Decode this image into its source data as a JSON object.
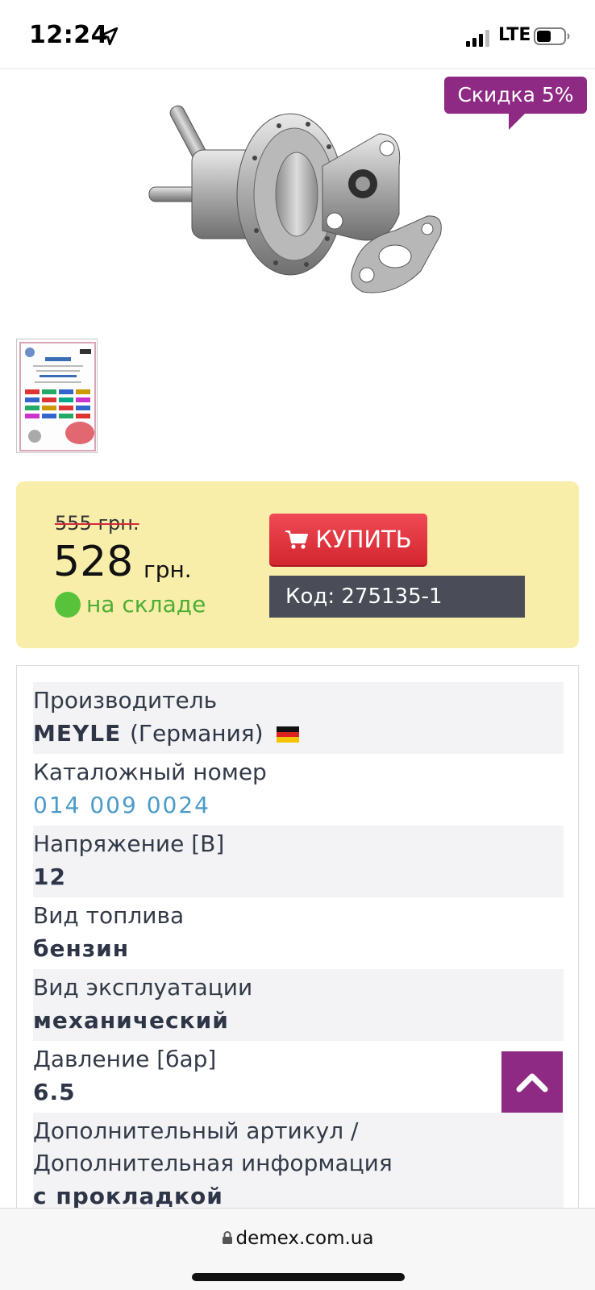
{
  "status_bar": {
    "time": "12:24",
    "network": "LTE"
  },
  "product": {
    "discount_badge": "Скидка 5%"
  },
  "price": {
    "old": "555 грн.",
    "new": "528",
    "currency": "грн.",
    "stock": "на складе",
    "buy_label": "КУПИТЬ",
    "code": "Код: 275135-1"
  },
  "specs": [
    {
      "label": "Производитель",
      "value": "MEYLE",
      "extra": "(Германия)"
    },
    {
      "label": "Каталожный номер",
      "value": "014 009 0024"
    },
    {
      "label": "Напряжение [В]",
      "value": "12"
    },
    {
      "label": "Вид топлива",
      "value": "бензин"
    },
    {
      "label": "Вид эксплуатации",
      "value": "механический"
    },
    {
      "label": "Давление [бар]",
      "value": "6.5"
    },
    {
      "label": "Дополнительный артикул / Дополнительная информация",
      "value": "с прокладкой"
    }
  ],
  "browser": {
    "url": "demex.com.ua"
  },
  "colors": {
    "accent": "#8e2a83",
    "buy": "#d3262f",
    "panel": "#f8eeaa",
    "stock": "#4dae33",
    "link": "#4a9bc9"
  }
}
